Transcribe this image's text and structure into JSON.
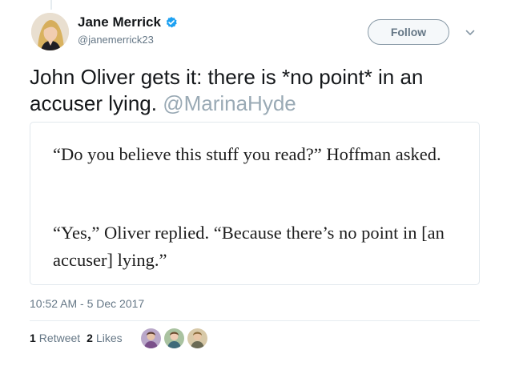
{
  "author": {
    "name": "Jane Merrick",
    "handle": "@janemerrick23",
    "avatar_icon": "profile-photo",
    "verified_icon": "verified-badge-icon"
  },
  "follow_label": "Follow",
  "tweet": {
    "text": "John Oliver gets it: there is *no point* in an accuser lying. ",
    "mention": "@MarinaHyde"
  },
  "quote_card": {
    "paragraphs": [
      "“Do you believe this stuff you read?” Hoffman asked.",
      "“Yes,” Oliver replied. “Because there’s no point in [an accuser] lying.”"
    ]
  },
  "timestamp": "10:52 AM - 5 Dec 2017",
  "stats": {
    "retweets_count": "1",
    "retweets_label": "Retweet",
    "likes_count": "2",
    "likes_label": "Likes"
  },
  "colors": {
    "verified_blue": "#1da1f2",
    "muted_text": "#657786",
    "mention_text": "#9aaab5"
  }
}
